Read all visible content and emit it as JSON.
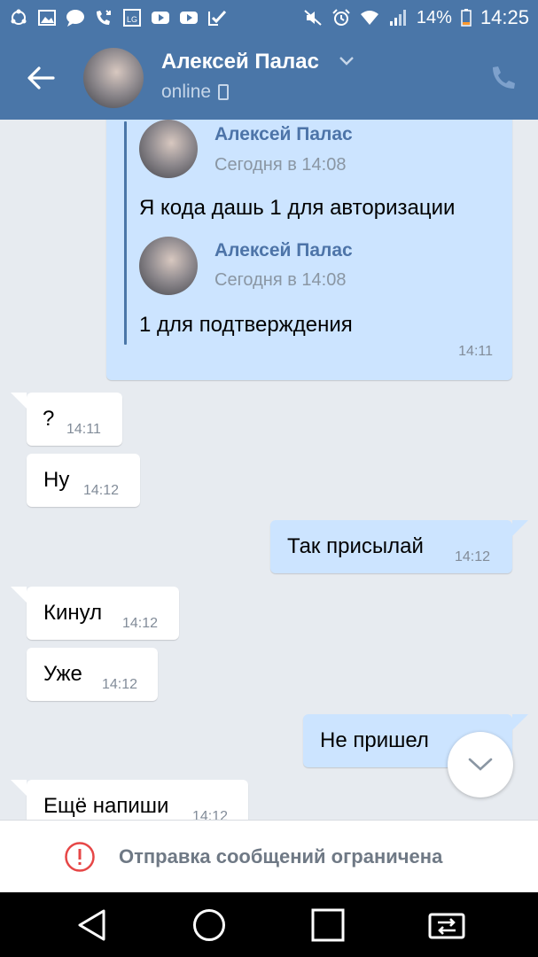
{
  "status_bar": {
    "battery_percent": "14%",
    "time": "14:25",
    "left_icons": [
      "sync-icon",
      "gallery-icon",
      "chat-icon",
      "missed-call-icon",
      "lg-icon",
      "youtube-icon",
      "youtube-icon",
      "check-icon"
    ],
    "right_icons": [
      "mute-icon",
      "alarm-icon",
      "wifi-icon",
      "signal-icon",
      "battery-icon"
    ]
  },
  "header": {
    "name": "Алексей Палас",
    "status": "online"
  },
  "forwarded": {
    "items": [
      {
        "name": "Алексей Палас",
        "date": "Сегодня в 14:08",
        "text": "Я кода дашь 1 для авторизации"
      },
      {
        "name": "Алексей Палас",
        "date": "Сегодня в 14:08",
        "text": "1 для подтверждения"
      }
    ],
    "time": "14:11"
  },
  "messages": [
    {
      "text": "?",
      "time": "14:11",
      "direction": "in"
    },
    {
      "text": "Ну",
      "time": "14:12",
      "direction": "in"
    },
    {
      "text": "Так присылай",
      "time": "14:12",
      "direction": "out"
    },
    {
      "text": "Кинул",
      "time": "14:12",
      "direction": "in"
    },
    {
      "text": "Уже",
      "time": "14:12",
      "direction": "in"
    },
    {
      "text": "Не пришел",
      "time": "",
      "direction": "out"
    },
    {
      "text": "Ещё напиши",
      "time": "14:12",
      "direction": "in"
    }
  ],
  "restriction": {
    "text": "Отправка сообщений ограничена"
  },
  "colors": {
    "header": "#4a76a8",
    "incoming": "#ffffff",
    "outgoing": "#cce4ff",
    "background": "#e7ebf0",
    "warning": "#e64646"
  }
}
